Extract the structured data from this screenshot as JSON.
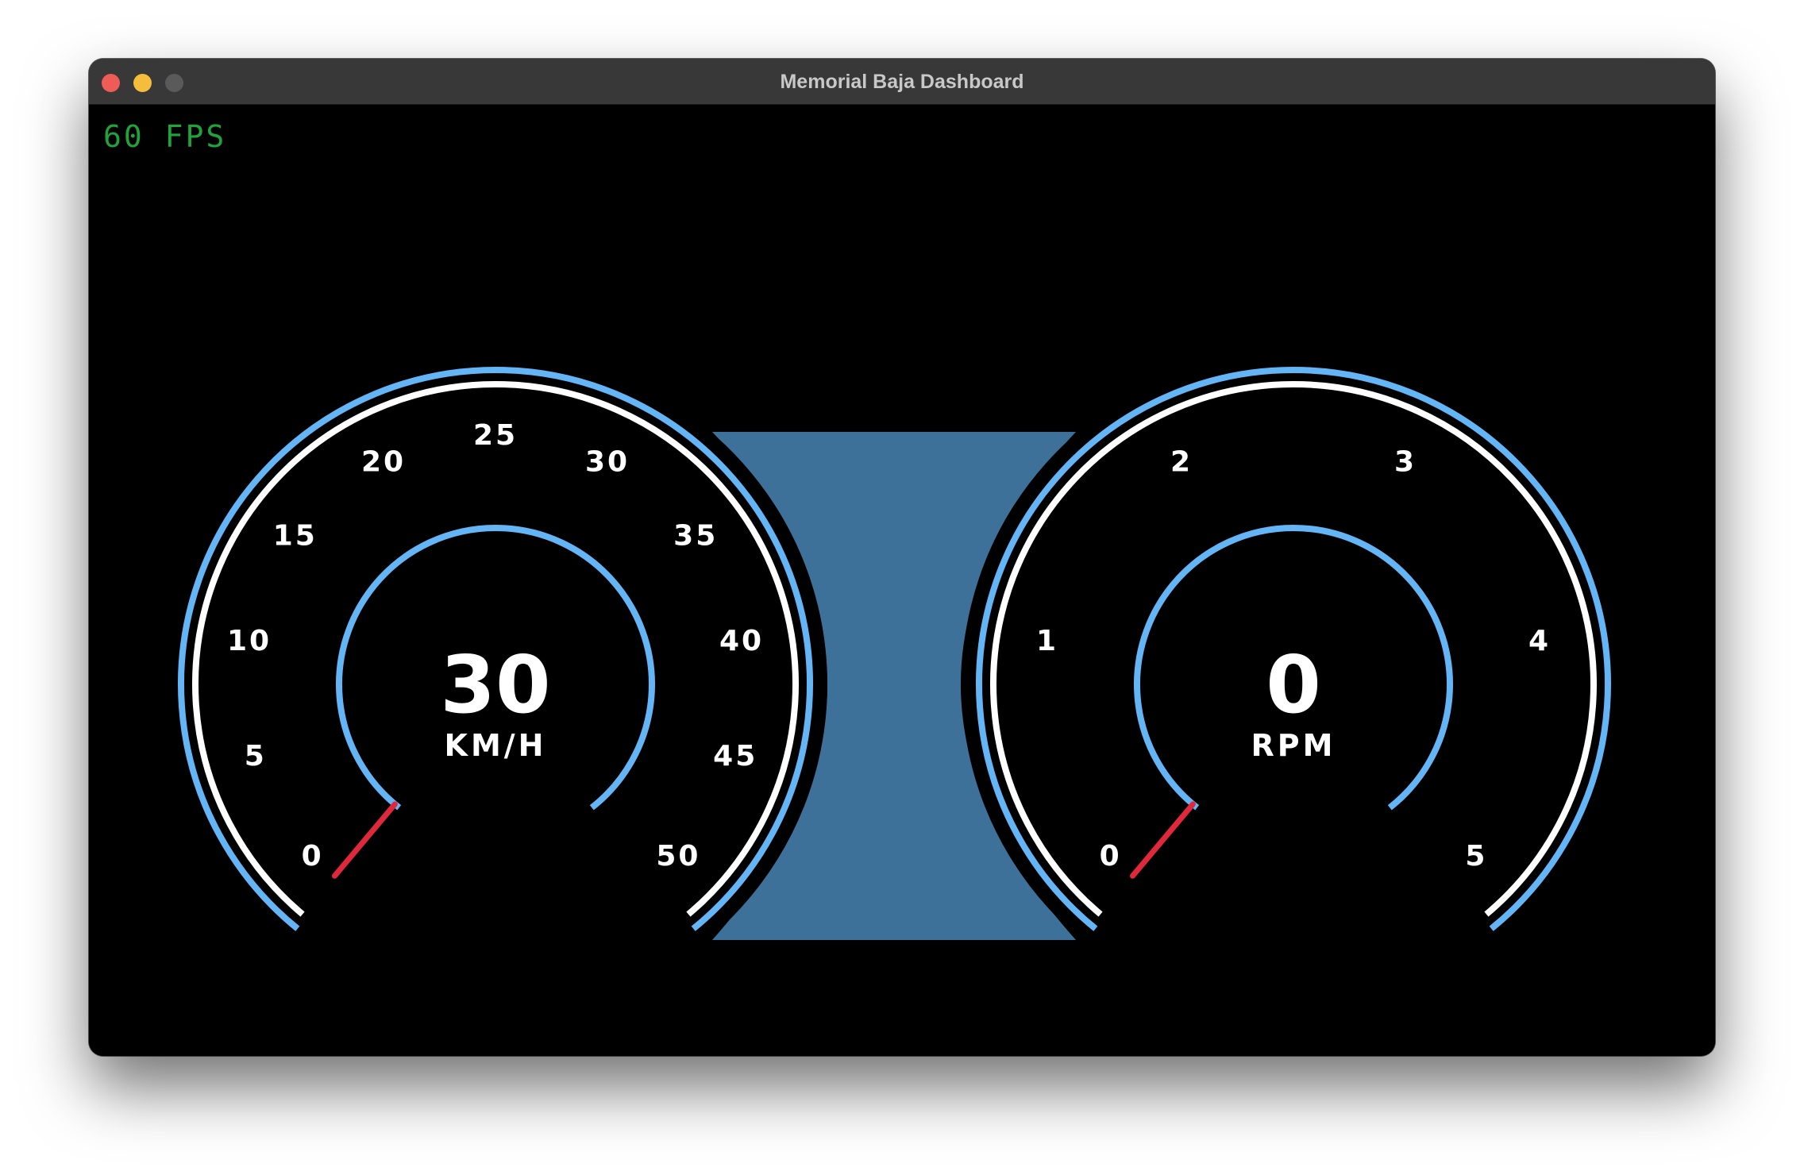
{
  "window": {
    "title": "Memorial Baja Dashboard"
  },
  "overlay": {
    "fps_text": "60 FPS",
    "fps_color": "#1fa33a"
  },
  "colors": {
    "outer_ring": "#64b5f6",
    "inner_ring": "#ffffff",
    "hub_ring": "#64b5f6",
    "needle": "#e0283c",
    "center_panel": "#3d7199",
    "background": "#000000"
  },
  "speedometer": {
    "min": 0,
    "max": 50,
    "value": 30,
    "value_text": "30",
    "unit": "KM/H",
    "tick_labels": [
      "0",
      "5",
      "10",
      "15",
      "20",
      "25",
      "30",
      "35",
      "40",
      "45",
      "50"
    ],
    "needle_value": 0
  },
  "tachometer": {
    "min": 0,
    "max": 5,
    "value": 0,
    "value_text": "0",
    "unit": "RPM",
    "tick_labels": [
      "0",
      "1",
      "2",
      "3",
      "4",
      "5"
    ],
    "needle_value": 0
  }
}
